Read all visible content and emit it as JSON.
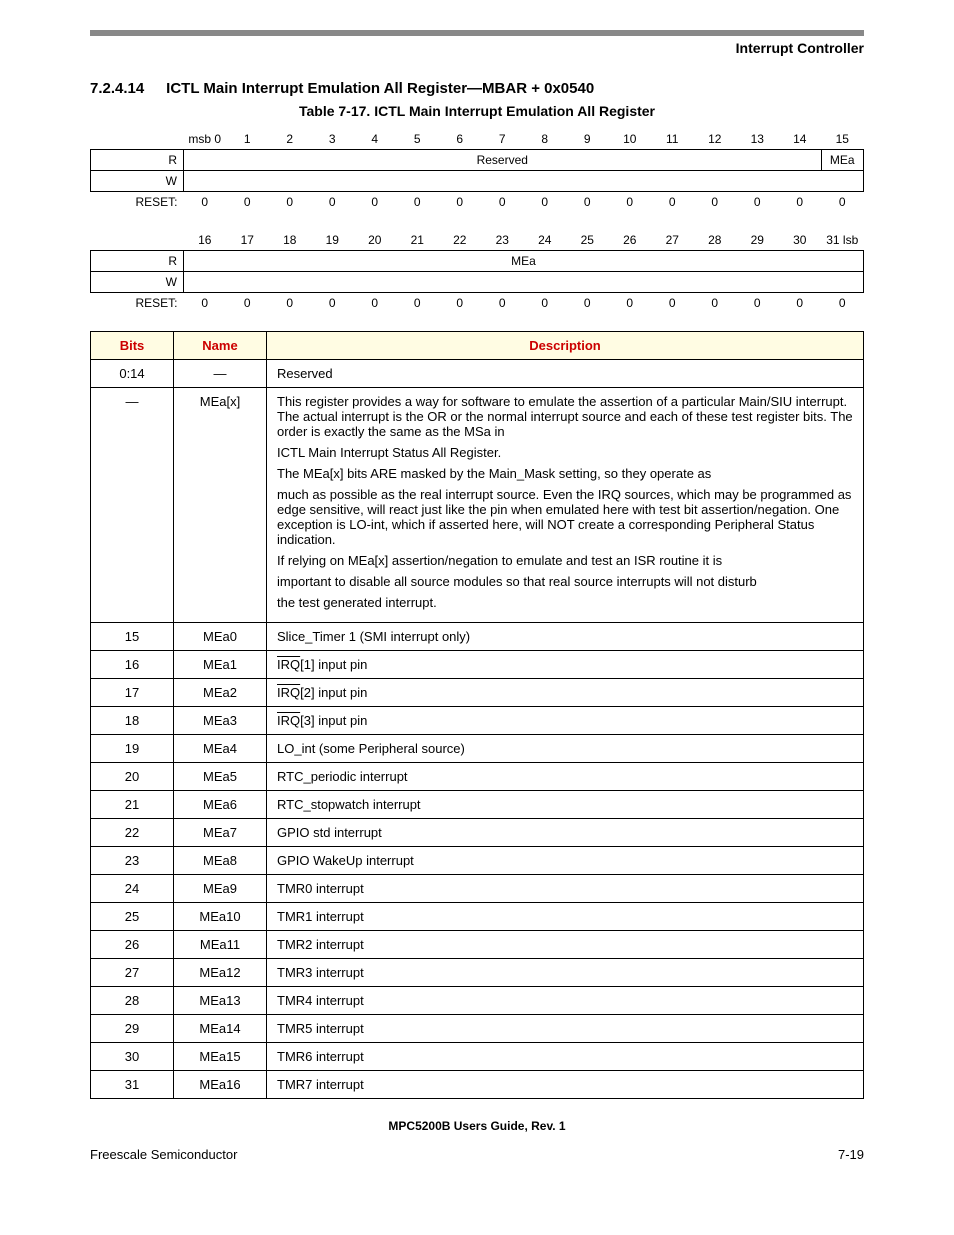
{
  "header": {
    "doc_section": "Interrupt Controller"
  },
  "section": {
    "number": "7.2.4.14",
    "title": "ICTL Main Interrupt Emulation All Register—MBAR + 0x0540",
    "caption": "Table 7-17. ICTL Main Interrupt Emulation All Register"
  },
  "bitmap": {
    "row1_bits": [
      "msb 0",
      "1",
      "2",
      "3",
      "4",
      "5",
      "6",
      "7",
      "8",
      "9",
      "10",
      "11",
      "12",
      "13",
      "14",
      "15"
    ],
    "row1_fieldA": "Reserved",
    "row1_fieldB": "MEa",
    "row1_reset": [
      "0",
      "0",
      "0",
      "0",
      "0",
      "0",
      "0",
      "0",
      "0",
      "0",
      "0",
      "0",
      "0",
      "0",
      "0",
      "0"
    ],
    "row2_bits": [
      "16",
      "17",
      "18",
      "19",
      "20",
      "21",
      "22",
      "23",
      "24",
      "25",
      "26",
      "27",
      "28",
      "29",
      "30",
      "31 lsb"
    ],
    "row2_field": "MEa",
    "row2_reset": [
      "0",
      "0",
      "0",
      "0",
      "0",
      "0",
      "0",
      "0",
      "0",
      "0",
      "0",
      "0",
      "0",
      "0",
      "0",
      "0"
    ],
    "labels": {
      "R": "R",
      "W": "W",
      "RESET": "RESET:"
    }
  },
  "desc": {
    "headers": {
      "bits": "Bits",
      "name": "Name",
      "desc": "Description"
    },
    "rows": [
      {
        "bits": "0:14",
        "name": "—",
        "desc_plain": "Reserved"
      },
      {
        "bits": "—",
        "name": "MEa[x]",
        "desc_paras": [
          "This register provides a way for software to emulate the assertion of a particular Main/SIU interrupt. The actual interrupt is the OR or the normal interrupt source and each of these test register bits. The order is exactly the same as the MSa in",
          "ICTL Main Interrupt Status All Register.",
          "The MEa[x] bits ARE masked by the Main_Mask setting, so they operate as",
          "much as possible as the real interrupt source. Even the IRQ sources, which may be programmed as edge sensitive, will react just like the pin when emulated here with test bit assertion/negation. One exception is LO-int, which if asserted here, will NOT create a corresponding Peripheral Status indication.",
          "If relying on MEa[x] assertion/negation to emulate and test an ISR routine it is",
          "important to disable all source modules so that real source interrupts will not disturb",
          "the test generated interrupt."
        ]
      },
      {
        "bits": "15",
        "name": "MEa0",
        "desc_plain": "Slice_Timer 1 (SMI interrupt only)"
      },
      {
        "bits": "16",
        "name": "MEa1",
        "desc_irq": "1",
        "desc_irq_suffix": " input pin"
      },
      {
        "bits": "17",
        "name": "MEa2",
        "desc_irq": "2",
        "desc_irq_suffix": " input pin"
      },
      {
        "bits": "18",
        "name": "MEa3",
        "desc_irq": "3",
        "desc_irq_suffix": " input pin"
      },
      {
        "bits": "19",
        "name": "MEa4",
        "desc_plain": "LO_int (some Peripheral source)"
      },
      {
        "bits": "20",
        "name": "MEa5",
        "desc_plain": "RTC_periodic interrupt"
      },
      {
        "bits": "21",
        "name": "MEa6",
        "desc_plain": "RTC_stopwatch interrupt"
      },
      {
        "bits": "22",
        "name": "MEa7",
        "desc_plain": "GPIO std interrupt"
      },
      {
        "bits": "23",
        "name": "MEa8",
        "desc_plain": "GPIO WakeUp interrupt"
      },
      {
        "bits": "24",
        "name": "MEa9",
        "desc_plain": "TMR0 interrupt"
      },
      {
        "bits": "25",
        "name": "MEa10",
        "desc_plain": "TMR1 interrupt"
      },
      {
        "bits": "26",
        "name": "MEa11",
        "desc_plain": "TMR2 interrupt"
      },
      {
        "bits": "27",
        "name": "MEa12",
        "desc_plain": "TMR3 interrupt"
      },
      {
        "bits": "28",
        "name": "MEa13",
        "desc_plain": "TMR4 interrupt"
      },
      {
        "bits": "29",
        "name": "MEa14",
        "desc_plain": "TMR5 interrupt"
      },
      {
        "bits": "30",
        "name": "MEa15",
        "desc_plain": "TMR6 interrupt"
      },
      {
        "bits": "31",
        "name": "MEa16",
        "desc_plain": "TMR7 interrupt"
      }
    ]
  },
  "footer": {
    "center": "MPC5200B Users Guide, Rev. 1",
    "left": "Freescale Semiconductor",
    "right": "7-19"
  },
  "irq_label": "IRQ"
}
